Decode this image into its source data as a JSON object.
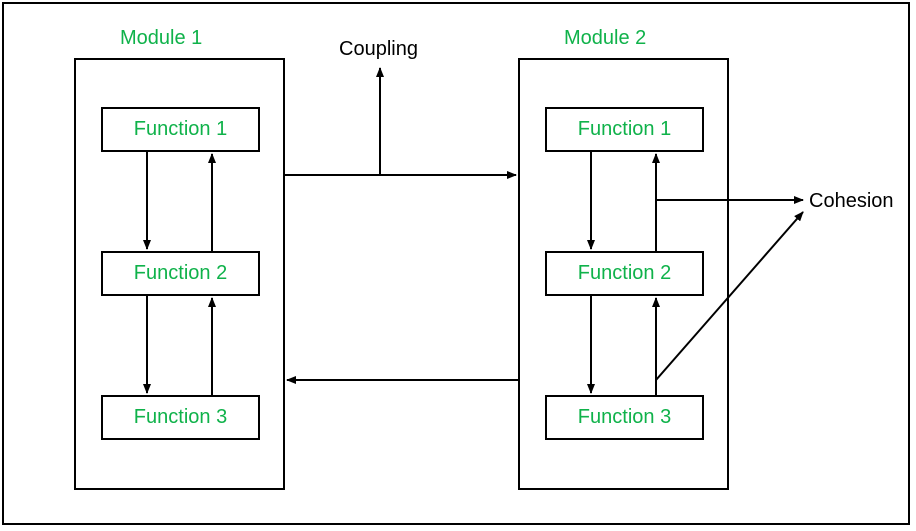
{
  "labels": {
    "module1": "Module 1",
    "module2": "Module 2",
    "coupling": "Coupling",
    "cohesion": "Cohesion"
  },
  "module1": {
    "func1": "Function 1",
    "func2": "Function 2",
    "func3": "Function 3"
  },
  "module2": {
    "func1": "Function 1",
    "func2": "Function 2",
    "func3": "Function 3"
  },
  "colors": {
    "accent": "#0fb24a",
    "line": "#000000"
  }
}
